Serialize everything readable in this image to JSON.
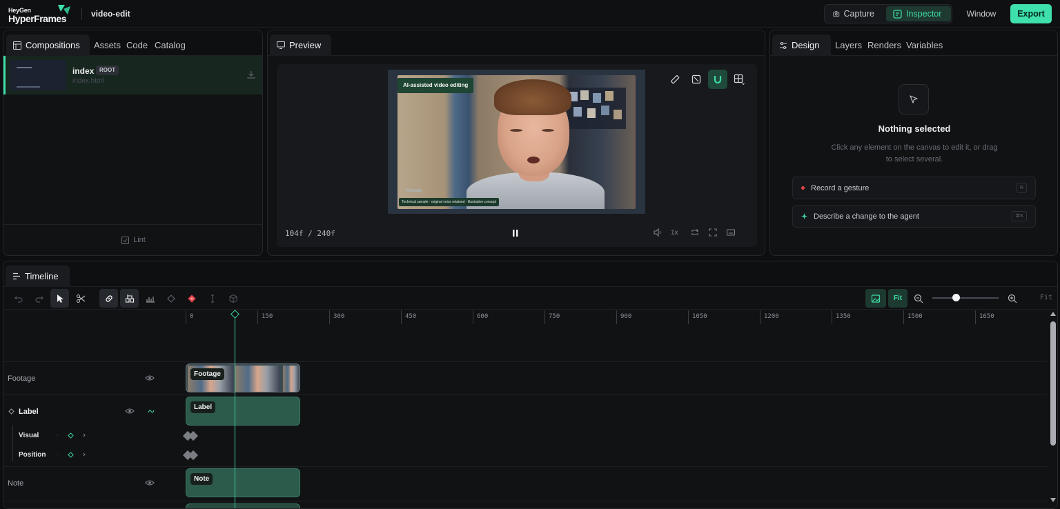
{
  "app": {
    "brand_top": "HeyGen",
    "brand_bottom": "HyperFrames",
    "project": "video-edit",
    "modes": {
      "capture": "Capture",
      "inspector": "Inspector"
    },
    "window_label": "Window",
    "export_label": "Export",
    "accent": "#3ee0ac"
  },
  "left_panel": {
    "tabs": [
      "Compositions",
      "Assets",
      "Code",
      "Catalog"
    ],
    "composition": {
      "name": "index",
      "badge": "ROOT",
      "file": "index.html"
    },
    "lint_label": "Lint"
  },
  "preview": {
    "tab": "Preview",
    "video_title": "AI-assisted video editing",
    "video_brand": "Priorality",
    "video_caption": "Technical sample · original voice retained · illustrative concept",
    "frame_counter": "104f / 240f",
    "speed": "1x"
  },
  "inspector": {
    "tabs": [
      "Design",
      "Layers",
      "Renders",
      "Variables"
    ],
    "empty_title": "Nothing selected",
    "empty_desc": "Click any element on the canvas to edit it, or drag to select several.",
    "actions": [
      {
        "label": "Record a gesture",
        "shortcut": "R"
      },
      {
        "label": "Describe a change to the agent",
        "shortcut": "⌘K"
      }
    ]
  },
  "timeline": {
    "tab": "Timeline",
    "fit_button": "Fit",
    "fit_label": "Fit",
    "zoom_level": 0.35,
    "ruler_ticks": [
      "0",
      "150",
      "300",
      "450",
      "600",
      "750",
      "900",
      "1050",
      "1200",
      "1350",
      "1500",
      "1650"
    ],
    "tracks": {
      "footage": "Footage",
      "label": "Label",
      "visual": "Visual",
      "position": "Position",
      "note": "Note"
    },
    "clips": {
      "footage": "Footage",
      "label": "Label",
      "note": "Note"
    }
  }
}
